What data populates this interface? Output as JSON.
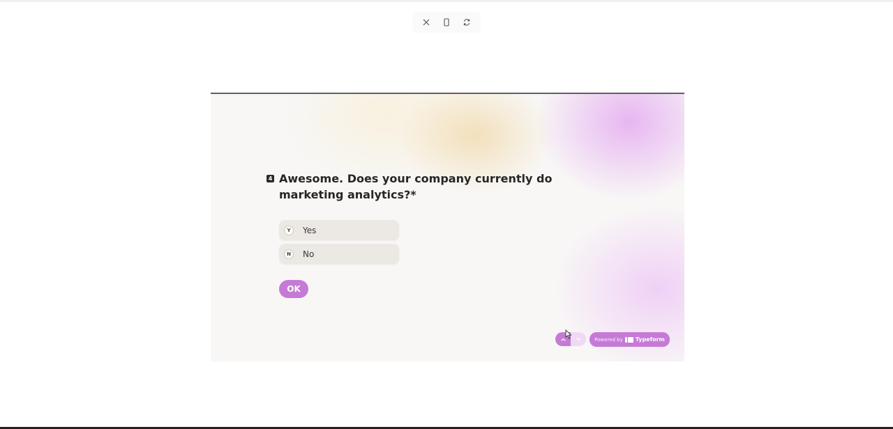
{
  "toolbar": {
    "icons": [
      "close-icon",
      "mobile-device-icon",
      "refresh-icon"
    ]
  },
  "form": {
    "question_number": "4",
    "question_text": "Awesome. Does your company currently do marketing analytics?",
    "required_marker": "*",
    "choices": [
      {
        "key": "Y",
        "label": "Yes"
      },
      {
        "key": "N",
        "label": "No"
      }
    ],
    "ok_label": "OK",
    "powered_by": "Powered by",
    "brand": "Typeform"
  },
  "colors": {
    "accent": "#c57ad6",
    "text": "#262626"
  }
}
